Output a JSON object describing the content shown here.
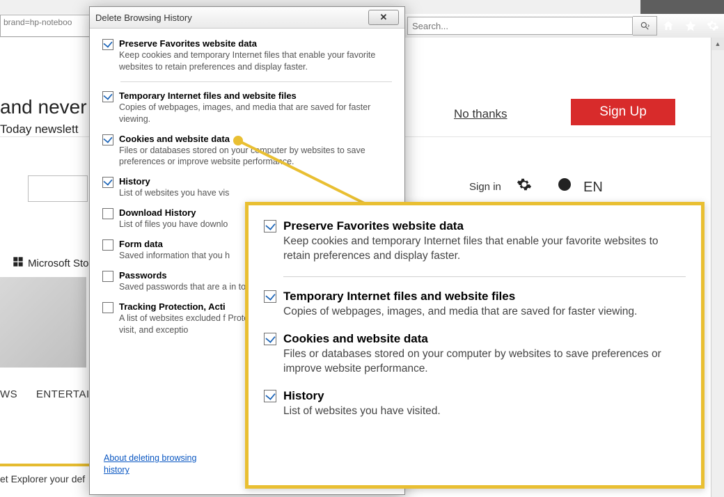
{
  "chrome": {
    "address_fragment": "brand=hp-noteboo",
    "search_placeholder": "Search...",
    "title_icons": [
      "home",
      "star",
      "gear"
    ]
  },
  "banner": {
    "line1": "and never",
    "line2": "Today newslett",
    "no_thanks": "No thanks",
    "sign_up": "Sign Up"
  },
  "header2": {
    "signin": "Sign in",
    "lang": "EN",
    "search_btn": "arch"
  },
  "nav": {
    "items": [
      "WS",
      "ENTERTAI"
    ]
  },
  "msstore": "Microsoft Store",
  "default_line": "et Explorer your def",
  "dialog": {
    "title": "Delete Browsing History",
    "about": "About deleting browsing history",
    "items": [
      {
        "checked": true,
        "title": "Preserve Favorites website data",
        "desc": "Keep cookies and temporary Internet files that enable your favorite websites to retain preferences and display faster."
      },
      {
        "checked": true,
        "title": "Temporary Internet files and website files",
        "desc": "Copies of webpages, images, and media that are saved for faster viewing."
      },
      {
        "checked": true,
        "title": "Cookies and website data",
        "desc": "Files or databases stored on your computer by websites to save preferences or improve website performance."
      },
      {
        "checked": true,
        "title": "History",
        "desc": "List of websites you have vis"
      },
      {
        "checked": false,
        "title": "Download History",
        "desc": "List of files you have downlo"
      },
      {
        "checked": false,
        "title": "Form data",
        "desc": "Saved information that you h"
      },
      {
        "checked": false,
        "title": "Passwords",
        "desc": "Saved passwords that are a​ in to a website you've previo"
      },
      {
        "checked": false,
        "title": "Tracking Protection, Acti",
        "desc": "A list of websites excluded f​ Protection to detect where s​ about your visit, and exceptio"
      }
    ]
  },
  "callout": {
    "items": [
      {
        "checked": true,
        "title": "Preserve Favorites website data",
        "desc": "Keep cookies and temporary Internet files that enable your favorite websites to retain preferences and display faster."
      },
      {
        "checked": true,
        "title": "Temporary Internet files and website files",
        "desc": "Copies of webpages, images, and media that are saved for faster viewing."
      },
      {
        "checked": true,
        "title": "Cookies and website data",
        "desc": "Files or databases stored on your computer by websites to save preferences or improve website performance."
      },
      {
        "checked": true,
        "title": "History",
        "desc": "List of websites you have visited."
      }
    ]
  }
}
